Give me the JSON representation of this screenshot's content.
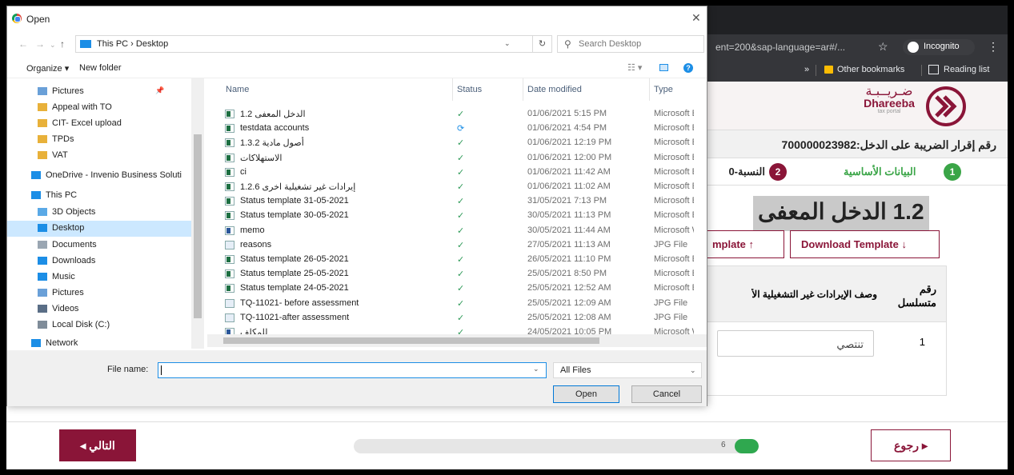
{
  "browser": {
    "url_fragment": "ent=200&sap-language=ar#/...",
    "incognito_label": "Incognito",
    "bookmarks_chevron": "»",
    "other_bookmarks": "Other bookmarks",
    "reading_list": "Reading list"
  },
  "app": {
    "logo_ar": "ضـريــبـة",
    "logo_en": "Dhareeba",
    "logo_sub": "tax portal",
    "declaration_label": "رقم إقرار الضريبة على الدخل:700000023982",
    "step1_number": "1",
    "step1_label": "البيانات الأساسية",
    "step2_number": "2",
    "step2_label": "النسبة-0",
    "section_title": "1.2 الدخل المعفى",
    "upload_label": "mplate",
    "download_label": "Download Template",
    "table": {
      "col_serial": "رقم متسلسل",
      "col_desc": "وصف الإيرادات غير التشغيلية الأ",
      "row1_number": "1",
      "row1_value": "تنتصي"
    },
    "next_label": "التالي",
    "back_label": "رجوع",
    "progress_label": "6",
    "progress_fraction": 0.06,
    "brand_color": "#8a1538",
    "success_color": "#3aa547"
  },
  "dialog": {
    "title": "Open",
    "path": "This PC  ›  Desktop",
    "search_placeholder": "Search Desktop",
    "organize": "Organize ▾",
    "new_folder": "New folder",
    "nav_items": [
      {
        "label": "Pictures",
        "icon": "pictures-icon",
        "pinned": true
      },
      {
        "label": "Appeal with TO",
        "icon": "folder-icon"
      },
      {
        "label": "CIT- Excel upload",
        "icon": "folder-icon"
      },
      {
        "label": "TPDs",
        "icon": "folder-icon"
      },
      {
        "label": "VAT",
        "icon": "folder-icon"
      },
      {
        "label": "OneDrive - Invenio Business Soluti",
        "icon": "onedrive-icon"
      },
      {
        "label": "This PC",
        "icon": "pc-icon"
      },
      {
        "label": "3D Objects",
        "icon": "3d-objects-icon"
      },
      {
        "label": "Desktop",
        "icon": "desktop-icon",
        "selected": true
      },
      {
        "label": "Documents",
        "icon": "documents-icon"
      },
      {
        "label": "Downloads",
        "icon": "downloads-icon"
      },
      {
        "label": "Music",
        "icon": "music-icon"
      },
      {
        "label": "Pictures",
        "icon": "pictures-icon"
      },
      {
        "label": "Videos",
        "icon": "videos-icon"
      },
      {
        "label": "Local Disk (C:)",
        "icon": "disk-icon"
      },
      {
        "label": "Network",
        "icon": "network-icon"
      }
    ],
    "columns": {
      "name": "Name",
      "status": "Status",
      "date": "Date modified",
      "type": "Type"
    },
    "files": [
      {
        "name": "الدخل المعفى 1.2",
        "status": "✓",
        "date": "01/06/2021 5:15 PM",
        "type": "Microsoft Ex",
        "kind": "excel"
      },
      {
        "name": "testdata accounts",
        "status": "⟳",
        "date": "01/06/2021 4:54 PM",
        "type": "Microsoft Ex",
        "kind": "excel"
      },
      {
        "name": "أصول مادية 1.3.2",
        "status": "✓",
        "date": "01/06/2021 12:19 PM",
        "type": "Microsoft Ex",
        "kind": "excel"
      },
      {
        "name": "الاستهلاكات",
        "status": "✓",
        "date": "01/06/2021 12:00 PM",
        "type": "Microsoft Ex",
        "kind": "excel"
      },
      {
        "name": "ci",
        "status": "✓",
        "date": "01/06/2021 11:42 AM",
        "type": "Microsoft Ex",
        "kind": "excel"
      },
      {
        "name": "إيرادات غير تشغيلية اخرى 1.2.6",
        "status": "✓",
        "date": "01/06/2021 11:02 AM",
        "type": "Microsoft Ex",
        "kind": "excel"
      },
      {
        "name": "Status template 31-05-2021",
        "status": "✓",
        "date": "31/05/2021 7:13 PM",
        "type": "Microsoft Ex",
        "kind": "excel"
      },
      {
        "name": "Status template 30-05-2021",
        "status": "✓",
        "date": "30/05/2021 11:13 PM",
        "type": "Microsoft Ex",
        "kind": "excel"
      },
      {
        "name": "memo",
        "status": "✓",
        "date": "30/05/2021 11:44 AM",
        "type": "Microsoft W",
        "kind": "word"
      },
      {
        "name": "reasons",
        "status": "✓",
        "date": "27/05/2021 11:13 AM",
        "type": "JPG File",
        "kind": "jpg"
      },
      {
        "name": "Status template 26-05-2021",
        "status": "✓",
        "date": "26/05/2021 11:10 PM",
        "type": "Microsoft Ex",
        "kind": "excel"
      },
      {
        "name": "Status template 25-05-2021",
        "status": "✓",
        "date": "25/05/2021 8:50 PM",
        "type": "Microsoft Ex",
        "kind": "excel"
      },
      {
        "name": "Status template 24-05-2021",
        "status": "✓",
        "date": "25/05/2021 12:52 AM",
        "type": "Microsoft Ex",
        "kind": "excel"
      },
      {
        "name": "TQ-11021- before assessment",
        "status": "✓",
        "date": "25/05/2021 12:09 AM",
        "type": "JPG File",
        "kind": "jpg"
      },
      {
        "name": "TQ-11021-after assessment",
        "status": "✓",
        "date": "25/05/2021 12:08 AM",
        "type": "JPG File",
        "kind": "jpg"
      },
      {
        "name": "للمكلف",
        "status": "✓",
        "date": "24/05/2021 10:05 PM",
        "type": "Microsoft W",
        "kind": "word"
      }
    ],
    "file_name_label": "File name:",
    "file_name_value": "",
    "filter": "All Files",
    "open": "Open",
    "cancel": "Cancel"
  }
}
